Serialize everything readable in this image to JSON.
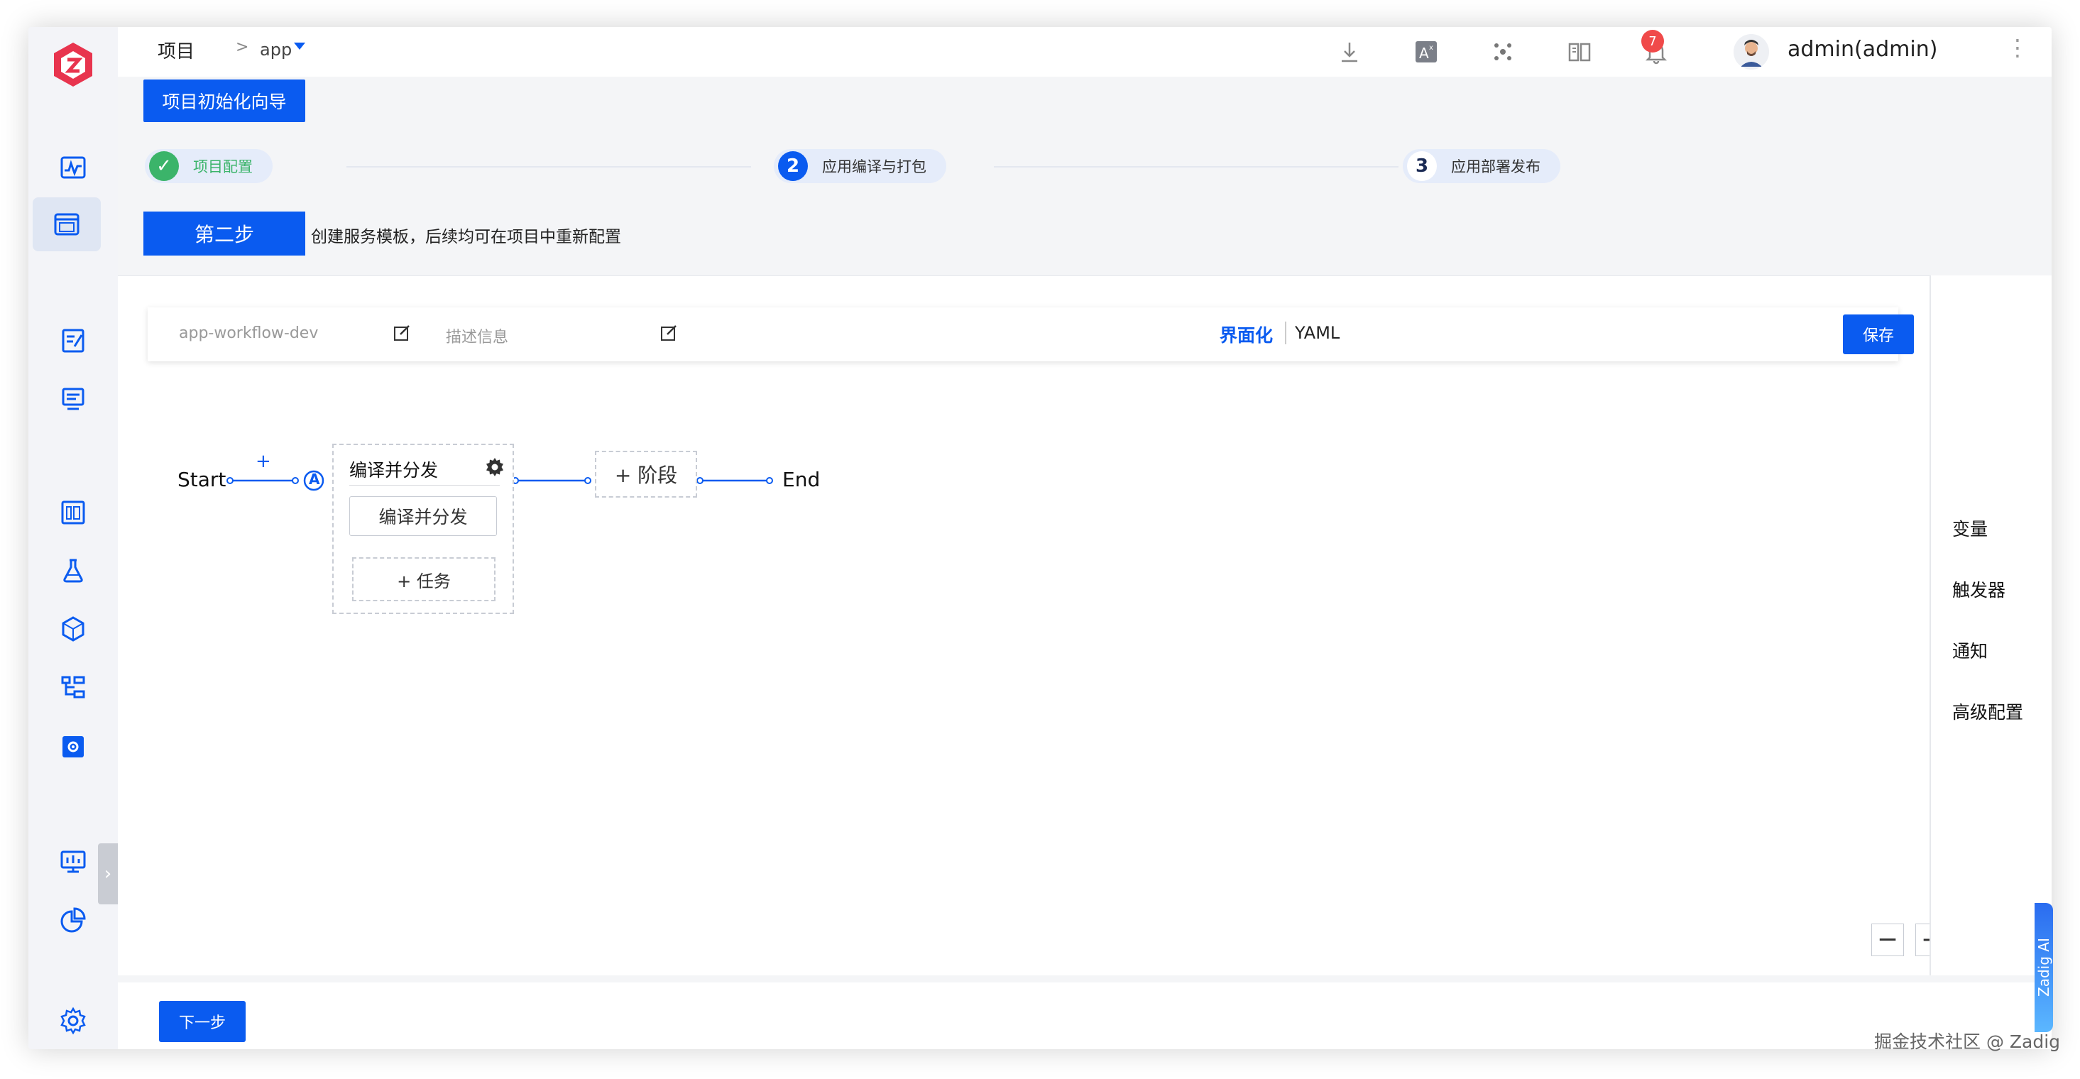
{
  "breadcrumb": {
    "project": "项目",
    "separator": ">",
    "app": "app"
  },
  "user": {
    "name": "admin(admin)"
  },
  "notifications": {
    "count": "7"
  },
  "wizard": {
    "title": "项目初始化向导",
    "steps": [
      {
        "num": "✓",
        "label": "项目配置"
      },
      {
        "num": "2",
        "label": "应用编译与打包"
      },
      {
        "num": "3",
        "label": "应用部署发布"
      }
    ],
    "current_tag": "第二步",
    "current_desc": "创建服务模板，后续均可在项目中重新配置"
  },
  "toolbar": {
    "workflow_name": "app-workflow-dev",
    "description_placeholder": "描述信息",
    "mode_ui": "界面化",
    "mode_yaml": "YAML",
    "save_label": "保存"
  },
  "pipeline": {
    "start": "Start",
    "end": "End",
    "add_symbol": "+",
    "marker": "A",
    "stage": {
      "title": "编译并分发",
      "job": "编译并分发",
      "add_task": "+ 任务"
    },
    "add_stage": "+ 阶段"
  },
  "right_panel": {
    "items": [
      "变量",
      "触发器",
      "通知",
      "高级配置"
    ]
  },
  "zoom": {
    "out": "−",
    "in": "+"
  },
  "footer": {
    "next_label": "下一步"
  },
  "ai_tab": "Zadig AI",
  "watermark": "掘金技术社区 @ Zadig",
  "colors": {
    "primary": "#0a5bf0",
    "success": "#3bb46a",
    "badge": "#f04a4a"
  }
}
